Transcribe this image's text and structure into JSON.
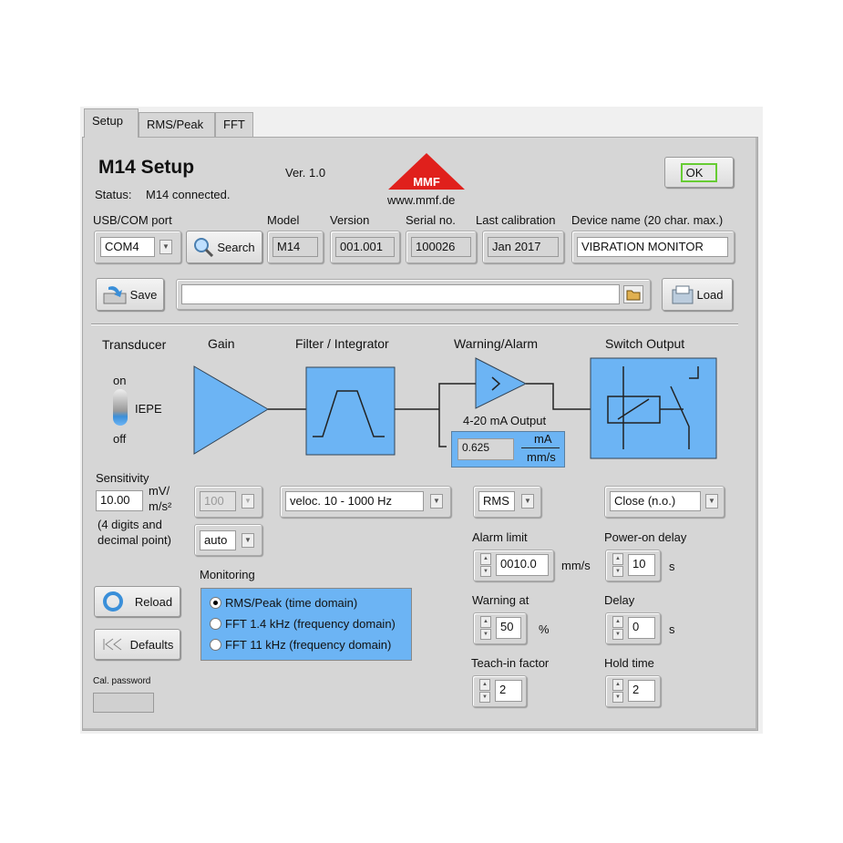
{
  "tabs": [
    {
      "label": "Setup",
      "active": true
    },
    {
      "label": "RMS/Peak"
    },
    {
      "label": "FFT"
    }
  ],
  "header": {
    "title": "M14 Setup",
    "version": "Ver. 1.0",
    "status_label": "Status:",
    "status_value": "M14 connected.",
    "logo_text": "MMF",
    "website": "www.mmf.de",
    "ok_label": "OK"
  },
  "device": {
    "port_label": "USB/COM port",
    "port_value": "COM4",
    "search_label": "Search",
    "model_label": "Model",
    "model": "M14",
    "version_label": "Version",
    "version": "001.001",
    "serial_label": "Serial no.",
    "serial": "100026",
    "cal_label": "Last calibration",
    "cal": "Jan  2017",
    "name_label": "Device name (20 char. max.)",
    "name": "VIBRATION MONITOR"
  },
  "file": {
    "save_label": "Save",
    "path": "",
    "load_label": "Load"
  },
  "diagram": {
    "transducer": "Transducer",
    "gain": "Gain",
    "filter": "Filter / Integrator",
    "warning": "Warning/Alarm",
    "switch": "Switch Output",
    "toggle_on": "on",
    "toggle_off": "off",
    "toggle_label": "IEPE",
    "toggle_state": "off",
    "output_title": "4-20 mA Output",
    "output_value": "0.625",
    "output_unit_top": "mA",
    "output_unit_bottom": "mm/s"
  },
  "sensitivity": {
    "label": "Sensitivity",
    "value": "10.00",
    "unit_top": "mV/",
    "unit_bottom": "m/s²",
    "note1": "(4 digits and",
    "note2": "decimal point)"
  },
  "gain": {
    "value": "100",
    "mode": "auto"
  },
  "filter": {
    "value": "veloc. 10 - 1000 Hz"
  },
  "detector": {
    "value": "RMS"
  },
  "switch": {
    "value": "Close (n.o.)"
  },
  "monitoring": {
    "label": "Monitoring",
    "options": [
      "RMS/Peak (time domain)",
      "FFT 1.4 kHz (frequency domain)",
      "FFT 11 kHz (frequency domain)"
    ],
    "selected": 0
  },
  "buttons": {
    "reload": "Reload",
    "defaults": "Defaults"
  },
  "password": {
    "label": "Cal. password",
    "value": ""
  },
  "alarm": {
    "limit_label": "Alarm limit",
    "limit": "0010.0",
    "limit_unit": "mm/s",
    "warn_label": "Warning at",
    "warn": "50",
    "warn_unit": "%",
    "teach_label": "Teach-in factor",
    "teach": "2"
  },
  "timing": {
    "pod_label": "Power-on delay",
    "pod": "10",
    "pod_unit": "s",
    "delay_label": "Delay",
    "delay": "0",
    "delay_unit": "s",
    "hold_label": "Hold time",
    "hold": "2"
  },
  "colors": {
    "panel": "#d6d6d6",
    "diagram_blue": "#6cb4f4",
    "logo_red": "#e0201c",
    "ok_border": "#66cc33"
  }
}
